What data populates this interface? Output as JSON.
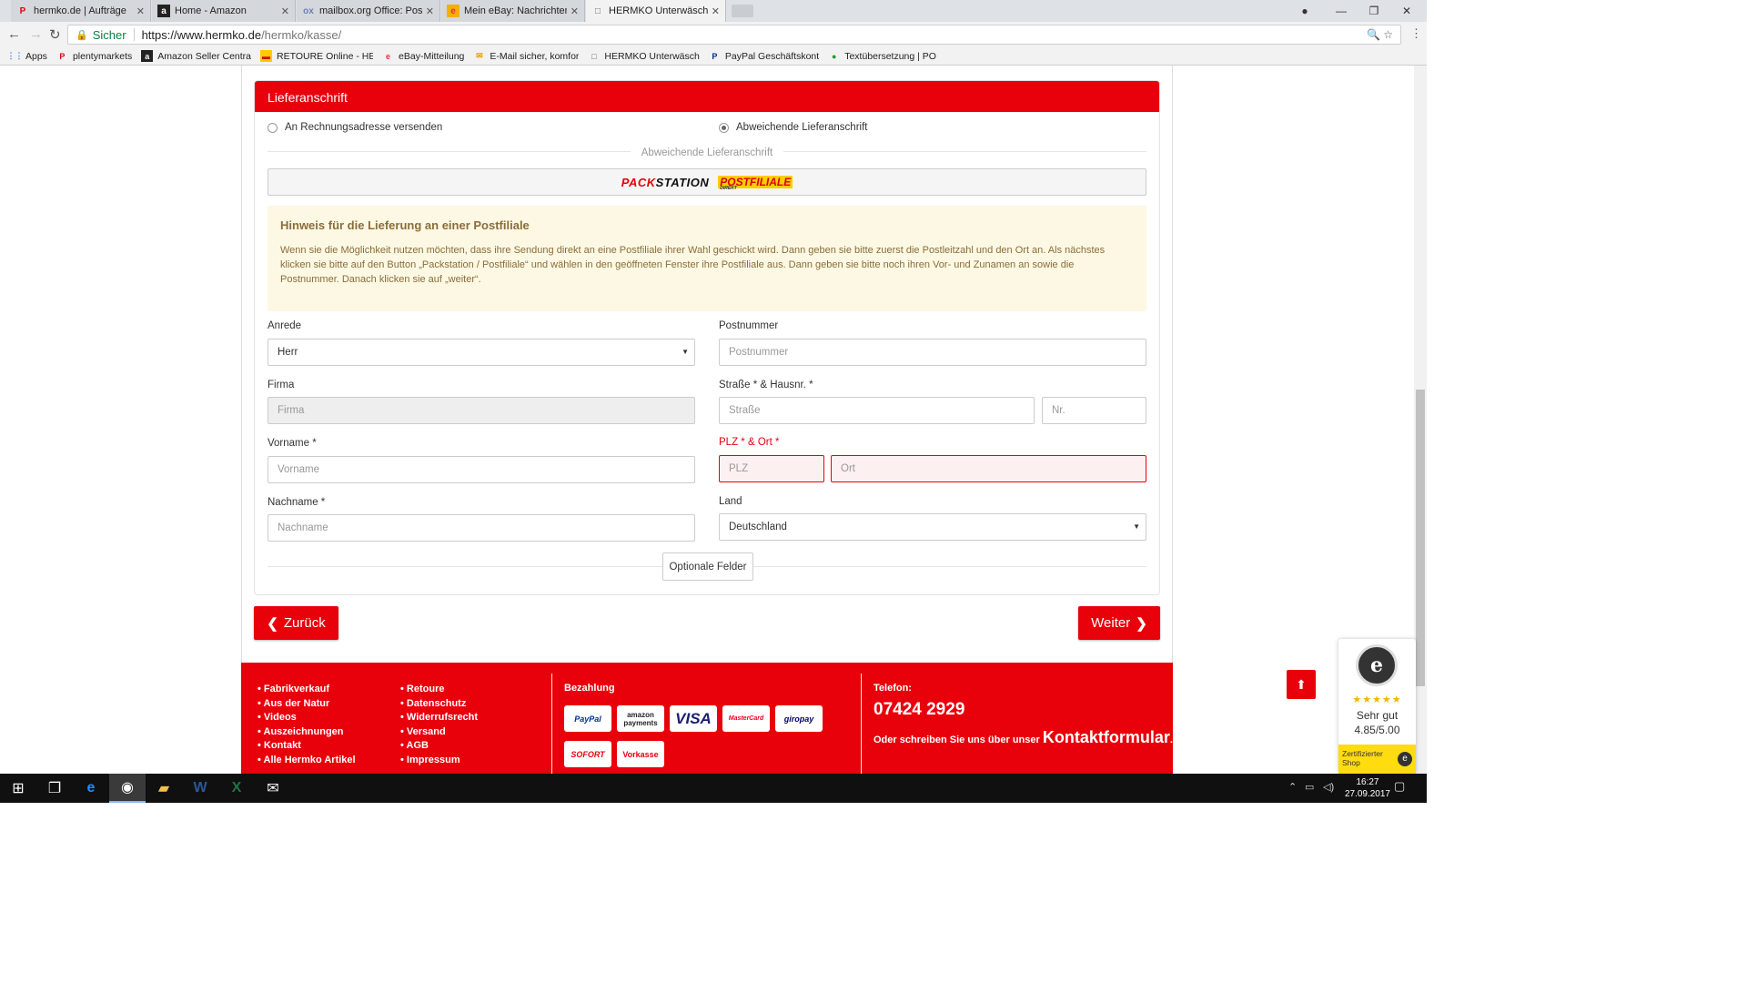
{
  "tabs": [
    {
      "title": "hermko.de | Aufträge",
      "favicon": "P",
      "color": "#e8000b"
    },
    {
      "title": "Home - Amazon",
      "favicon": "a",
      "color": "#222"
    },
    {
      "title": "mailbox.org Office: Poste",
      "favicon": "ox",
      "color": "#6a7fb5"
    },
    {
      "title": "Mein eBay: Nachrichten",
      "favicon": "e",
      "color": "#e53238"
    },
    {
      "title": "HERMKO Unterwäsche",
      "favicon": "□",
      "color": "#666"
    }
  ],
  "address": {
    "secure_label": "Sicher",
    "url_host": "https://www.hermko.de",
    "url_path": "/hermko/kasse/"
  },
  "bookmarks": [
    {
      "label": "Apps",
      "icon": "⋮⋮"
    },
    {
      "label": "plentymarkets",
      "icon": "P"
    },
    {
      "label": "Amazon Seller Centra",
      "icon": "a"
    },
    {
      "label": "RETOURE Online - HE",
      "icon": "▬"
    },
    {
      "label": "eBay-Mitteilung",
      "icon": "e"
    },
    {
      "label": "E-Mail sicher, komfor",
      "icon": "✉"
    },
    {
      "label": "HERMKO Unterwäsch",
      "icon": "□"
    },
    {
      "label": "PayPal Geschäftskont",
      "icon": "P"
    },
    {
      "label": "Textübersetzung | PO",
      "icon": "●"
    }
  ],
  "panel": {
    "title": "Lieferanschrift",
    "radio_billing": "An Rechnungsadresse versenden",
    "radio_alt": "Abweichende Lieferanschrift",
    "divider": "Abweichende Lieferanschrift",
    "packstation_a": "PACK",
    "packstation_b": "STATION",
    "postfiliale": "POSTFILIALE",
    "postfiliale_sub": "DIREKT",
    "note_title": "Hinweis für die Lieferung an einer Postfiliale",
    "note_text": "Wenn sie die Möglichkeit nutzen möchten, dass ihre Sendung direkt an eine Postfiliale ihrer Wahl geschickt wird. Dann geben sie bitte zuerst die Postleitzahl und den Ort an. Als nächstes klicken sie bitte auf den Button „Packstation / Postfiliale“ und wählen in den geöffneten Fenster ihre Postfiliale aus. Dann geben sie bitte noch ihren Vor- und Zunamen an sowie die Postnummer. Danach klicken sie auf „weiter“.",
    "labels": {
      "anrede": "Anrede",
      "postnummer": "Postnummer",
      "firma": "Firma",
      "strasse": "Straße * & Hausnr. *",
      "vorname": "Vorname *",
      "plz": "PLZ * & Ort *",
      "nachname": "Nachname *",
      "land": "Land"
    },
    "values": {
      "anrede": "Herr",
      "land": "Deutschland"
    },
    "placeholders": {
      "postnummer": "Postnummer",
      "firma": "Firma",
      "strasse": "Straße",
      "nr": "Nr.",
      "vorname": "Vorname",
      "plz": "PLZ",
      "ort": "Ort",
      "nachname": "Nachname"
    },
    "optional": "Optionale Felder"
  },
  "buttons": {
    "back": "Zurück",
    "next": "Weiter"
  },
  "footer": {
    "col1": [
      "Fabrikverkauf",
      "Aus der Natur",
      "Videos",
      "Auszeichnungen",
      "Kontakt",
      "Alle Hermko Artikel"
    ],
    "col2": [
      "Retoure",
      "Datenschutz",
      "Widerrufsrecht",
      "Versand",
      "AGB",
      "Impressum"
    ],
    "payment_title": "Bezahlung",
    "payments": [
      "PayPal",
      "amazon payments",
      "VISA",
      "MasterCard",
      "giropay",
      "SOFORT",
      "Vorkasse"
    ],
    "phone_label": "Telefon:",
    "phone": "07424 2929",
    "contact_text": "Oder schreiben Sie uns über unser ",
    "contact_link": "Kontaktformular",
    "contact_end": "."
  },
  "trusted": {
    "stars": "★★★★★",
    "rating_label": "Sehr gut",
    "score": "4.85/5.00",
    "badge": "Zertifizierter Shop"
  },
  "taskbar": {
    "time": "16:27",
    "date": "27.09.2017"
  },
  "colors": {
    "brand": "#e8000b",
    "note_bg": "#fcf8e3",
    "note_text": "#8a6d3b"
  }
}
